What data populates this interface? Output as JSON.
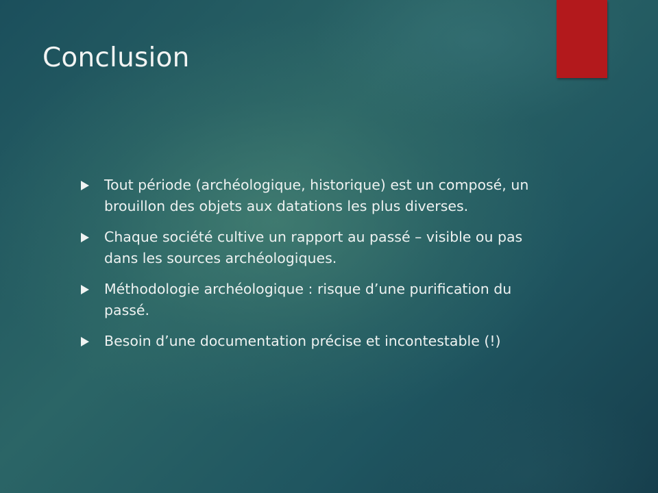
{
  "slide": {
    "title": "Conclusion",
    "accent_color": "#b3191c",
    "bullet_icon": "triangle-bullet-icon",
    "bullets": [
      {
        "text": "Tout période (archéologique, historique) est un composé, un brouillon des objets aux datations les plus diverses."
      },
      {
        "text": "Chaque société cultive un rapport au passé – visible ou pas dans les sources archéologiques."
      },
      {
        "text": "Méthodologie archéologique : risque d’une purification du passé."
      },
      {
        "text": "Besoin d’une documentation précise et incontestable (!)"
      }
    ]
  }
}
